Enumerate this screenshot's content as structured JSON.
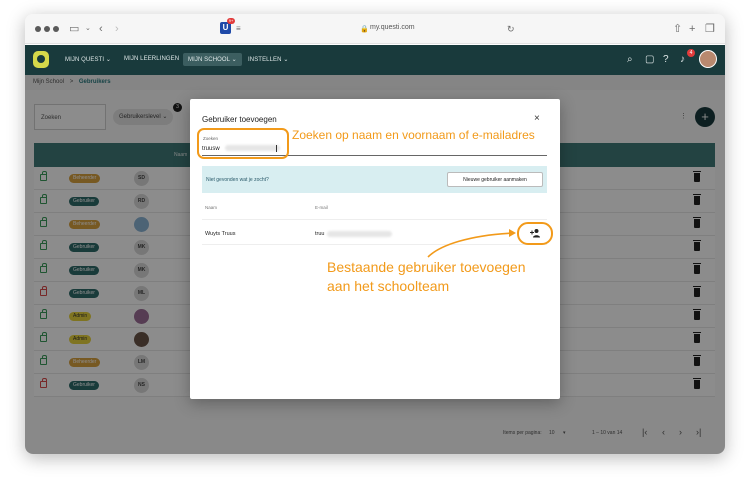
{
  "browser": {
    "url": "my.questi.com",
    "app_badge": "9+"
  },
  "nav": {
    "items": [
      "MIJN QUESTI ⌄",
      "MIJN LEERLINGEN",
      "MIJN SCHOOL ⌄",
      "INSTELLEN ⌄"
    ],
    "active_index": 2,
    "notification_count": "4"
  },
  "breadcrumb": {
    "root": "Mijn School",
    "separator": ">",
    "current": "Gebruikers"
  },
  "toolbar": {
    "search_label": "Zoeken",
    "filter_label": "Gebruikerslevel ⌄",
    "filter_badge": "3",
    "add_button": "+",
    "more": "⋮"
  },
  "table": {
    "column_name": "Naam",
    "rows": [
      {
        "badge": "Beheerder",
        "type": "beheerder",
        "initials": "SD",
        "lock": "green"
      },
      {
        "badge": "Gebruiker",
        "type": "gebruiker",
        "initials": "RD",
        "lock": "green"
      },
      {
        "badge": "Beheerder",
        "type": "beheerder",
        "initials": "",
        "lock": "green",
        "photo": "#8bb4d6"
      },
      {
        "badge": "Gebruiker",
        "type": "gebruiker",
        "initials": "MK",
        "lock": "green"
      },
      {
        "badge": "Gebruiker",
        "type": "gebruiker",
        "initials": "MK",
        "lock": "green"
      },
      {
        "badge": "Gebruiker",
        "type": "gebruiker",
        "initials": "ML",
        "lock": "red"
      },
      {
        "badge": "Admin",
        "type": "admin",
        "initials": "",
        "lock": "green",
        "photo": "#9d6e97"
      },
      {
        "badge": "Admin",
        "type": "admin",
        "initials": "",
        "lock": "green",
        "photo": "#6b5548"
      },
      {
        "badge": "Beheerder",
        "type": "beheerder",
        "initials": "LM",
        "lock": "green"
      },
      {
        "badge": "Gebruiker",
        "type": "gebruiker",
        "initials": "NS",
        "lock": "red"
      }
    ]
  },
  "pagination": {
    "items_per_page_label": "Items per pagina:",
    "items_per_page": "10",
    "range": "1 – 10 van 14"
  },
  "modal": {
    "title": "Gebruiker toevoegen",
    "close": "×",
    "search_label": "Zoeken",
    "search_value": "truusw",
    "not_found_text": "Niet gevonden wat je zocht?",
    "new_user_button": "Nieuwe gebruiker aanmaken",
    "col_name": "Naam",
    "col_email": "E-mail",
    "result": {
      "name": "Wuyts Truus",
      "email": "truu"
    }
  },
  "annotations": {
    "search_hint": "Zoeken op naam en voornaam of e-mailadres",
    "add_hint_line1": "Bestaande gebruiker toevoegen",
    "add_hint_line2": "aan het schoolteam",
    "color": "#f29a1a"
  }
}
